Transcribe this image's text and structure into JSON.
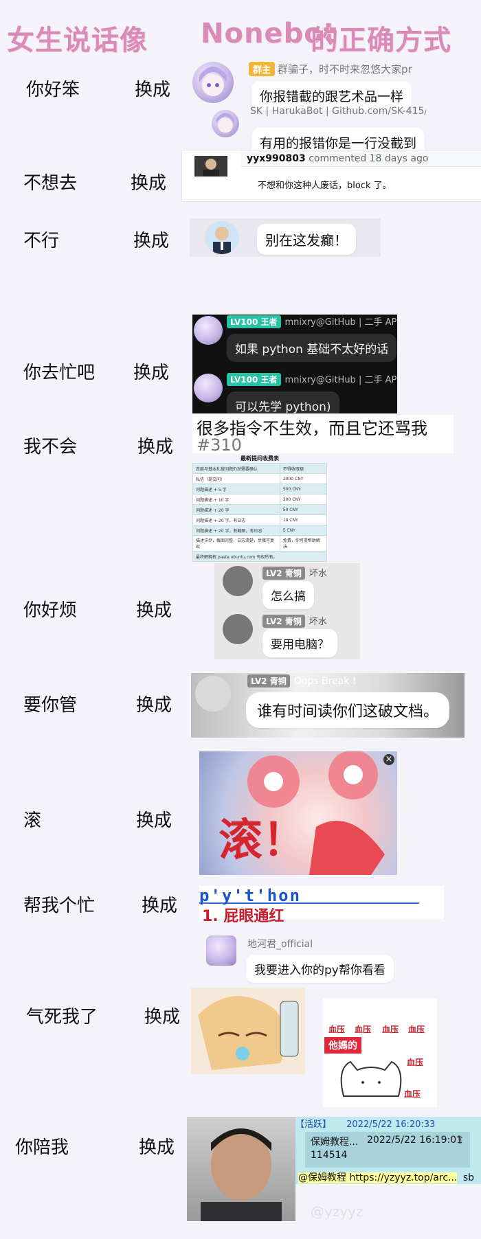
{
  "title": {
    "part1": "女生说话像",
    "part2": "Nonebot",
    "part3": "的正确方式"
  },
  "swap_label": "换成",
  "rows": [
    {
      "label": "你好笨"
    },
    {
      "label": "不想去"
    },
    {
      "label": "不行"
    },
    {
      "label": "你去忙吧"
    },
    {
      "label": "我不会"
    },
    {
      "label": "你好烦"
    },
    {
      "label": "要你管"
    },
    {
      "label": "滚"
    },
    {
      "label": "帮我个忙"
    },
    {
      "label": "气死我了"
    },
    {
      "label": "你陪我"
    }
  ],
  "r1": {
    "badge": "群主",
    "sender": "群骗子，时不时来忽悠大家pr",
    "msg1": "你报错截的跟艺术品一样",
    "sender2": "SK | HarukaBot | Github.com/SK-415/",
    "msg2": "有用的报错你是一行没截到"
  },
  "r2": {
    "user": "yyx990803",
    "meta": "commented 18 days ago",
    "msg": "不想和你这种人废话，block 了。"
  },
  "r3": {
    "msg": "别在这发癫！"
  },
  "r4": {
    "lv": "LV100 王者",
    "sender": "mnixry@GitHub | 二手 API",
    "msg1": "如果 python 基础不太好的话",
    "msg2": "可以先学 python)"
  },
  "r5": {
    "headline": "很多指令不生效，而且它还骂我",
    "issue": "#310",
    "table_title": "最新提问收费表",
    "table": [
      [
        "态度与基本礼貌问题仍然需要确认",
        "不得收取额"
      ],
      [
        "私信（提交问）",
        "2000 CNY"
      ],
      [
        "问题描述 + 5 字",
        "500 CNY"
      ],
      [
        "问题描述 + 10 字",
        "200 CNY"
      ],
      [
        "问题描述 + 20 字",
        "50 CNY"
      ],
      [
        "问题描述 + 20 字，有日志",
        "10 CNY"
      ],
      [
        "问题描述 + 20 字，有截图，有日志",
        "5 CNY"
      ],
      [
        "描述详尽，截图完整，日志清楚，步骤可复现",
        "免费，你可提帮助解决"
      ]
    ],
    "table_footer": "最终解释权 paste.ubuntu.com 有权所有。"
  },
  "r6": {
    "lv": "LV2 青铜",
    "sender": "坏水",
    "msg1": "怎么搞",
    "msg2": "要用电脑？"
  },
  "r7": {
    "lv": "LV2 青铜",
    "sender": "Oops Break !",
    "msg": "谁有时间读你们这破文档。"
  },
  "r8": {
    "glyph": "滚！",
    "close": "×"
  },
  "r9": {
    "typed": "p'y't'hon",
    "suggestion": "1. 屁眼通红"
  },
  "r10": {
    "sender": "地河君_official",
    "msg": "我要进入你的py帮你看看",
    "stamp_text": "他媽的",
    "stamp_word": "血压"
  },
  "r11": {
    "tag": "【活跃】",
    "time1": "2022/5/22 16:20:33",
    "quote_name": "保姆教程...",
    "quote_time": "2022/5/22 16:19:01",
    "quote_text": "114514",
    "link": "@保姆教程 https://yzyyz.top/arc...",
    "tail": "sb",
    "watermark": "@yzyyz"
  },
  "colors": {
    "title": "#d98bb8",
    "bubble": "#ffffff",
    "dark": "#111111"
  }
}
